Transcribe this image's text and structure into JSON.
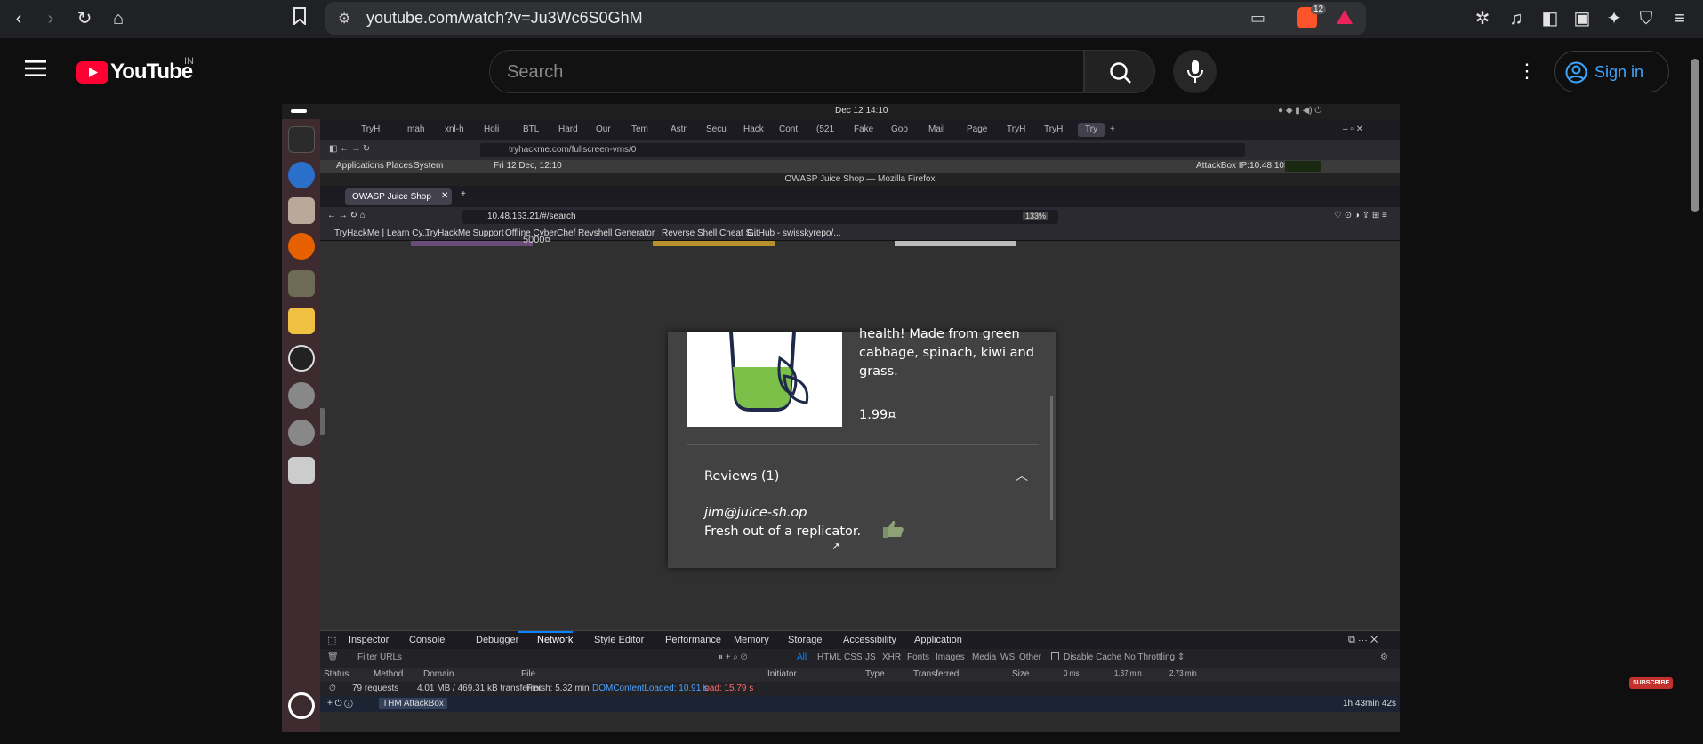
{
  "browser": {
    "url": "youtube.com/watch?v=Ju3Wc6S0GhM",
    "brave_badge": "12"
  },
  "youtube": {
    "logo_text": "YouTube",
    "region": "IN",
    "search_placeholder": "Search",
    "sign_in": "Sign in",
    "subscribe_badge": "SUBSCRIBE"
  },
  "video": {
    "desktop": {
      "clock": "Dec 12  14:10"
    },
    "vm_tabs": [
      "TryH",
      "mah",
      "xnl-h",
      "Holi",
      "BTL",
      "Hard",
      "Our",
      "Tem",
      "Astr",
      "Secu",
      "Hack",
      "Cont",
      "(521",
      "Fake",
      "Goo",
      "Mail",
      "Page",
      "TryH",
      "TryH",
      "Try"
    ],
    "vm_url": "tryhackme.com/fullscreen-vms/0",
    "panel": {
      "applications": "Applications",
      "places": "Places",
      "system": "System",
      "datetime": "Fri 12 Dec, 12:10",
      "attackbox_ip": "AttackBox IP:10.48.105.119"
    },
    "window_title": "OWASP Juice Shop — Mozilla Firefox",
    "firefox": {
      "tab_title": "OWASP Juice Shop",
      "url": "10.48.163.21/#/search",
      "zoom": "133%",
      "bookmarks": [
        "TryHackMe | Learn Cy...",
        "TryHackMe Support",
        "Offline CyberChef",
        "Revshell Generator",
        "Reverse Shell Cheat S...",
        "GitHub - swisskyrepo/..."
      ]
    },
    "juice": {
      "top_fragment": "5000¤",
      "description": "health! Made from green cabbage, spinach, kiwi and grass.",
      "price": "1.99¤",
      "reviews_heading": "Reviews (1)",
      "review_user": "jim@juice-sh.op",
      "review_text": "Fresh out of a replicator."
    },
    "devtools": {
      "tabs": [
        "Inspector",
        "Console",
        "Debugger",
        "Network",
        "Style Editor",
        "Performance",
        "Memory",
        "Storage",
        "Accessibility",
        "Application"
      ],
      "filter_placeholder": "Filter URLs",
      "type_filters": [
        "All",
        "HTML",
        "CSS",
        "JS",
        "XHR",
        "Fonts",
        "Images",
        "Media",
        "WS",
        "Other"
      ],
      "disable_cache": "Disable Cache",
      "throttling": "No Throttling ⇕",
      "columns": [
        "Status",
        "Method",
        "Domain",
        "File",
        "Initiator",
        "Type",
        "Transferred",
        "Size"
      ],
      "timeline_ticks": [
        "0 ms",
        "1.37 min",
        "2.73 min"
      ],
      "requests": "79 requests",
      "transferred": "4.01 MB / 469.31 kB transferred",
      "finish": "Finish: 5.32 min",
      "domcontentloaded": "DOMContentLoaded: 10.91 s",
      "load": "load: 15.79 s"
    },
    "bottom_bar": {
      "attackbox": "THM AttackBox",
      "timer": "1h 43min 42s"
    }
  }
}
